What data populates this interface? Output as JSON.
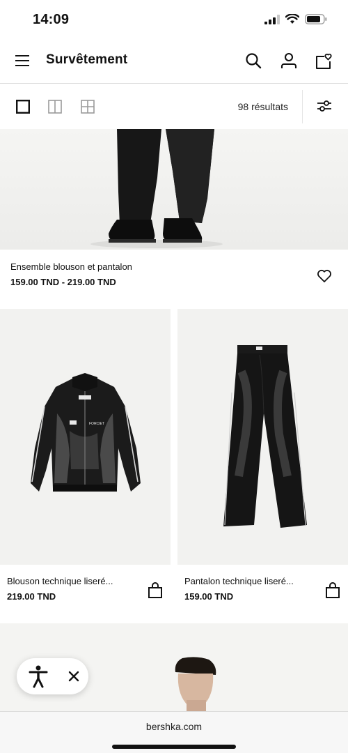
{
  "status_bar": {
    "time": "14:09"
  },
  "header": {
    "title": "Survêtement"
  },
  "toolbar": {
    "results": "98 résultats"
  },
  "hero_product": {
    "name": "Ensemble blouson et pantalon",
    "price": "159.00 TND - 219.00 TND"
  },
  "products": [
    {
      "name": "Blouson technique liseré...",
      "price": "219.00 TND",
      "logo_text": "FORCIET"
    },
    {
      "name": "Pantalon technique liseré...",
      "price": "159.00 TND"
    }
  ],
  "browser": {
    "url": "bershka.com"
  },
  "colors": {
    "background": "#ffffff",
    "image_bg": "#f2f2f0",
    "text": "#111111",
    "divider": "#d9d9d9"
  },
  "icons": [
    "menu-icon",
    "search-icon",
    "account-icon",
    "wishlist-bag-icon",
    "filter-icon",
    "heart-icon",
    "bag-icon",
    "accessibility-icon",
    "close-icon"
  ]
}
